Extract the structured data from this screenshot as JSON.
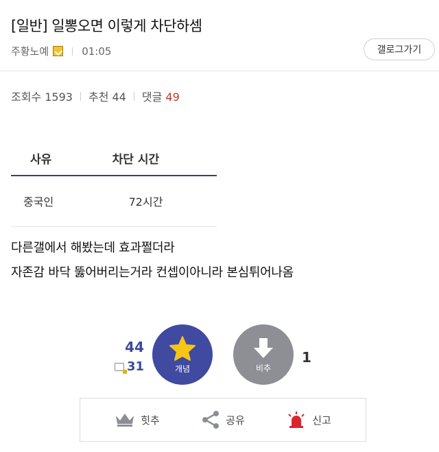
{
  "post": {
    "title": "[일반] 일뽕오면 이렇게 차단하셈",
    "author": "주황노예",
    "time": "01:05",
    "gallog_button": "갤로그가기"
  },
  "stats": {
    "views_label": "조회수 1593",
    "recommend_label": "추천 44",
    "comments_label": "댓글",
    "comments_count": "49"
  },
  "table": {
    "headers": [
      "사유",
      "차단 시간"
    ],
    "rows": [
      [
        "중국인",
        "72시간"
      ]
    ]
  },
  "body": {
    "lines": [
      "다른갤에서 해봤는데 효과쩔더라",
      "자존감 바닥 뚫어버리는거라 컨셉이아니라 본심튀어나옴"
    ]
  },
  "vote": {
    "up_count": "44",
    "fixed_count": "31",
    "up_label": "개념",
    "down_label": "비추",
    "down_count": "1",
    "up_color": "#3f4aa0",
    "down_color": "#8e8f94",
    "star_color": "#f5c518"
  },
  "actions": {
    "hit": "힛추",
    "share": "공유",
    "report": "신고"
  }
}
